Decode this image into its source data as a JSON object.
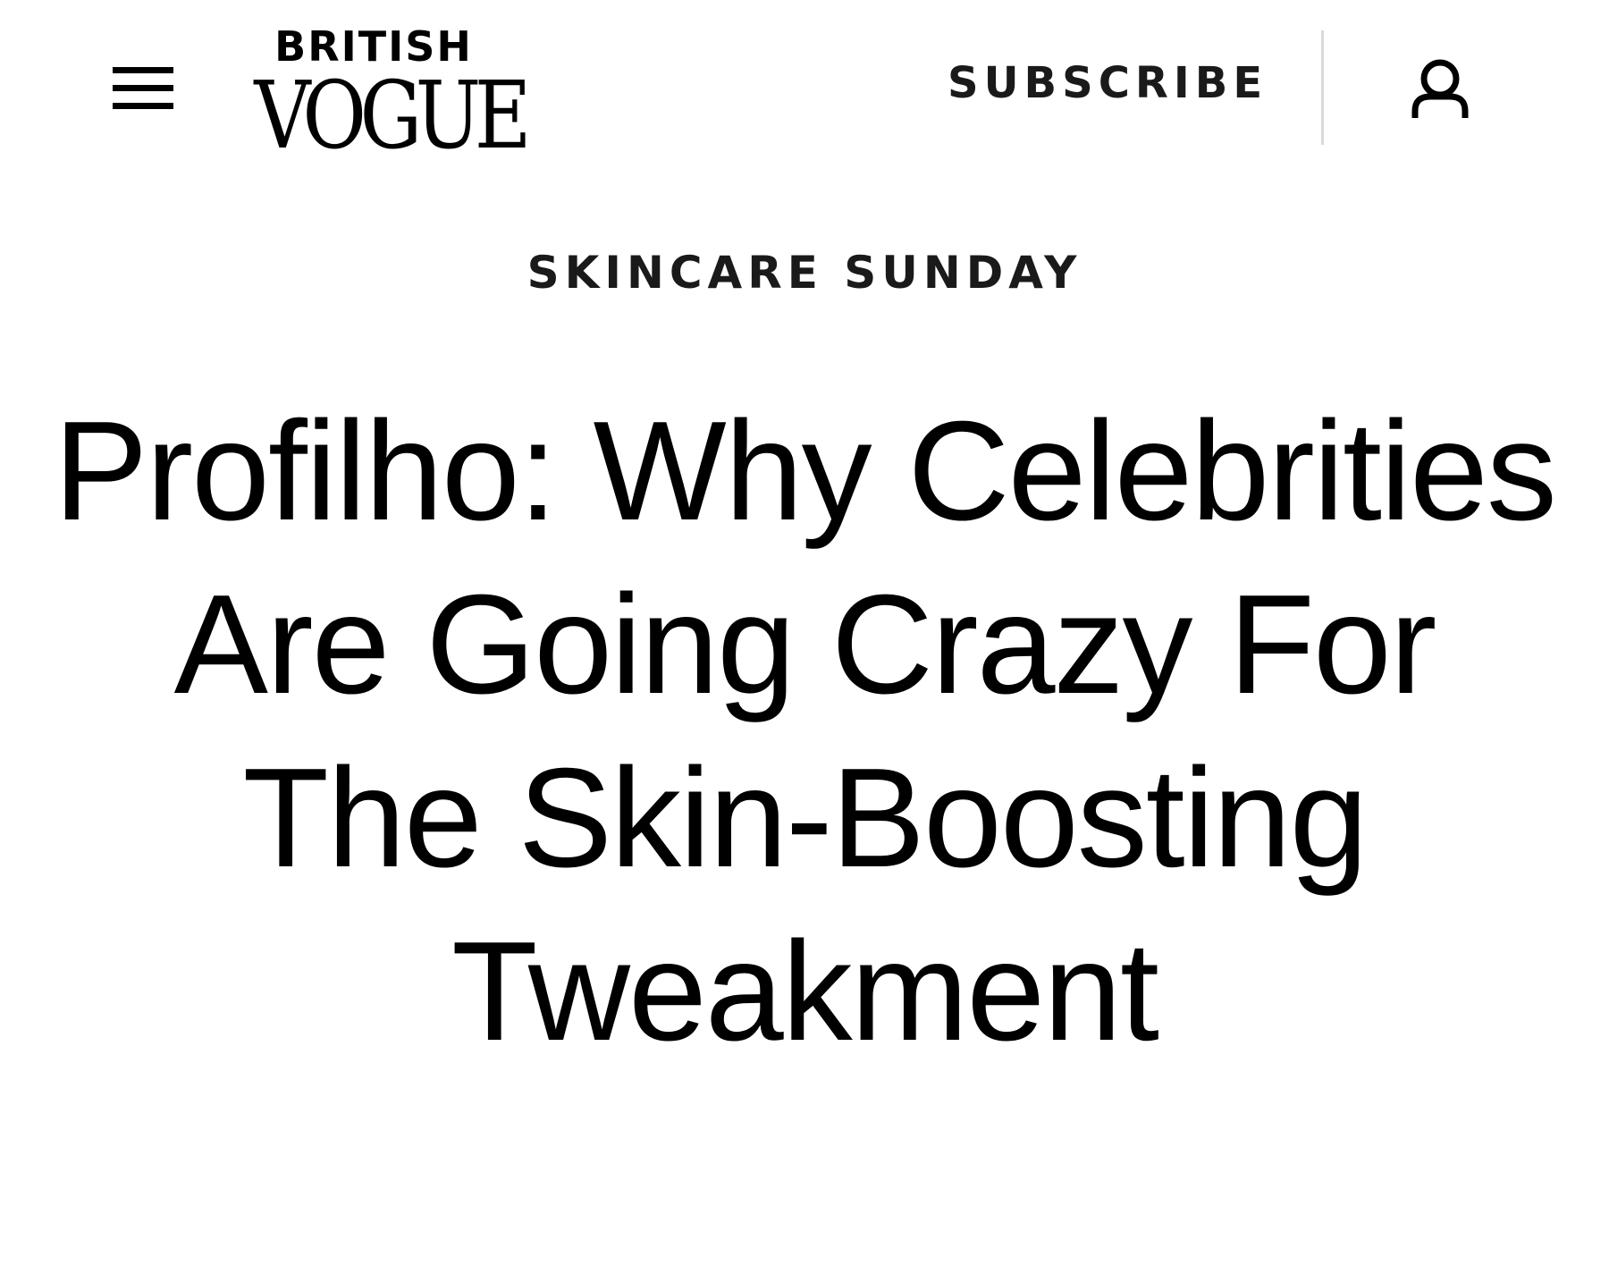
{
  "header": {
    "menu_icon": "hamburger-menu-icon",
    "logo": {
      "top": "BRITISH",
      "bottom": "VOGUE"
    },
    "subscribe_label": "SUBSCRIBE",
    "account_icon": "user-account-icon"
  },
  "article": {
    "rubric": "SKINCARE SUNDAY",
    "headline": "Profilho: Why Celebrities Are Going Crazy For The Skin-Boosting Tweakment"
  }
}
